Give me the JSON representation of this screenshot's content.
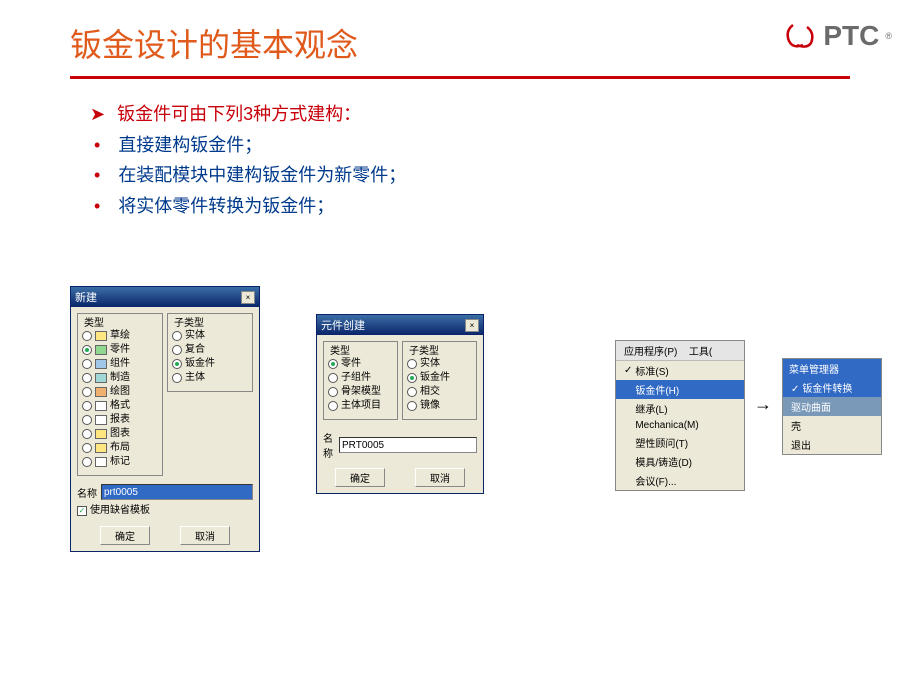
{
  "title": "钣金设计的基本观念",
  "logo_text": "PTC",
  "bullets": {
    "main": "钣金件可由下列3种方式建构：",
    "subs": [
      "直接建构钣金件；",
      "在装配模块中建构钣金件为新零件；",
      "将实体零件转换为钣金件；"
    ]
  },
  "dlg1": {
    "title": "新建",
    "groups": {
      "type": "类型",
      "subtype": "子类型"
    },
    "types": [
      {
        "icon": "ic-yellow",
        "label": "草绘",
        "selected": false
      },
      {
        "icon": "ic-green",
        "label": "零件",
        "selected": true
      },
      {
        "icon": "ic-blue",
        "label": "组件",
        "selected": false
      },
      {
        "icon": "ic-teal",
        "label": "制造",
        "selected": false
      },
      {
        "icon": "ic-orange",
        "label": "绘图",
        "selected": false
      },
      {
        "icon": "ic-white",
        "label": "格式",
        "selected": false
      },
      {
        "icon": "ic-white",
        "label": "报表",
        "selected": false
      },
      {
        "icon": "ic-yellow",
        "label": "图表",
        "selected": false
      },
      {
        "icon": "ic-yellow",
        "label": "布局",
        "selected": false
      },
      {
        "icon": "ic-white",
        "label": "标记",
        "selected": false
      }
    ],
    "subtypes": [
      {
        "label": "实体",
        "selected": false
      },
      {
        "label": "复合",
        "selected": false
      },
      {
        "label": "钣金件",
        "selected": true
      },
      {
        "label": "主体",
        "selected": false
      }
    ],
    "name_label": "名称",
    "name_value": "prt0005",
    "template_chk": "使用缺省模板",
    "ok": "确定",
    "cancel": "取消"
  },
  "dlg2": {
    "title": "元件创建",
    "groups": {
      "type": "类型",
      "subtype": "子类型"
    },
    "types": [
      {
        "label": "零件",
        "selected": true
      },
      {
        "label": "子组件",
        "selected": false
      },
      {
        "label": "骨架模型",
        "selected": false
      },
      {
        "label": "主体项目",
        "selected": false
      }
    ],
    "subtypes": [
      {
        "label": "实体",
        "selected": false
      },
      {
        "label": "钣金件",
        "selected": true
      },
      {
        "label": "相交",
        "selected": false
      },
      {
        "label": "镜像",
        "selected": false
      }
    ],
    "name_label": "名称",
    "name_value": "PRT0005",
    "ok": "确定",
    "cancel": "取消"
  },
  "menu3": {
    "header_items": [
      "应用程序(P)",
      "工具("
    ],
    "items": [
      {
        "label": "标准(S)",
        "sel": false,
        "chk": true
      },
      {
        "label": "钣金件(H)",
        "sel": true
      },
      {
        "label": "继承(L)",
        "sel": false
      },
      {
        "label": "Mechanica(M)",
        "sel": false
      },
      {
        "label": "塑性顾问(T)",
        "sel": false
      },
      {
        "label": "模具/铸造(D)",
        "sel": false
      },
      {
        "label": "会议(F)...",
        "sel": false
      }
    ]
  },
  "menu4": {
    "header": "菜单管理器",
    "items": [
      {
        "label": "钣金件转换",
        "sel": true,
        "chk": true
      },
      {
        "label": "驱动曲面",
        "sel": false,
        "darkbg": true
      },
      {
        "label": "壳",
        "sel": false
      },
      {
        "label": "退出",
        "sel": false
      }
    ]
  }
}
